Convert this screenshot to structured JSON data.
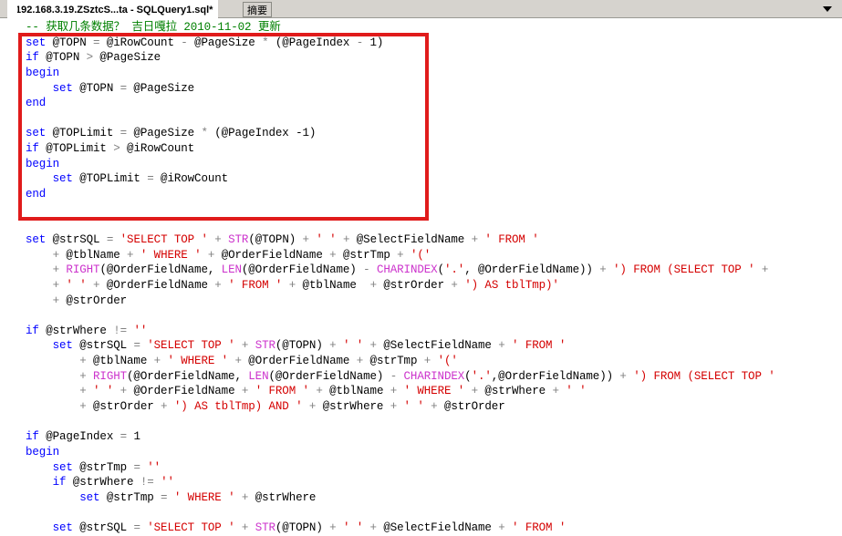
{
  "window": {
    "tab_title": "192.168.3.19.ZSztcS...ta - SQLQuery1.sql*",
    "summary_tab_label": "摘要",
    "dropdown_icon": "chevron-down-icon"
  },
  "annotation": {
    "box_color": "#e01b1b",
    "shape": "rectangle",
    "covers_lines": "1-13"
  },
  "colors": {
    "comment": "#008000",
    "keyword": "#0000ff",
    "string": "#d40000",
    "function": "#cc33cc",
    "operator": "#808080",
    "identifier": "#000000",
    "tabstrip_bg": "#d6d3ce",
    "editor_bg": "#ffffff"
  },
  "editor": {
    "language": "T-SQL",
    "lines": [
      [
        {
          "t": "-- 获取几条数据？ 吉日嘎拉 2010-11-02 更新",
          "c": "cm"
        }
      ],
      [
        {
          "t": "set",
          "c": "kw"
        },
        {
          "t": " @TOPN ",
          "c": "var"
        },
        {
          "t": "=",
          "c": "op"
        },
        {
          "t": " @iRowCount ",
          "c": "var"
        },
        {
          "t": "-",
          "c": "op"
        },
        {
          "t": " @PageSize ",
          "c": "var"
        },
        {
          "t": "*",
          "c": "op"
        },
        {
          "t": " (@PageIndex ",
          "c": "var"
        },
        {
          "t": "-",
          "c": "op"
        },
        {
          "t": " 1)",
          "c": "var"
        }
      ],
      [
        {
          "t": "if",
          "c": "kw"
        },
        {
          "t": " @TOPN ",
          "c": "var"
        },
        {
          "t": ">",
          "c": "op"
        },
        {
          "t": " @PageSize",
          "c": "var"
        }
      ],
      [
        {
          "t": "begin",
          "c": "kw"
        }
      ],
      [
        {
          "t": "    set",
          "c": "kw"
        },
        {
          "t": " @TOPN ",
          "c": "var"
        },
        {
          "t": "=",
          "c": "op"
        },
        {
          "t": " @PageSize",
          "c": "var"
        }
      ],
      [
        {
          "t": "end",
          "c": "kw"
        }
      ],
      [
        {
          "t": "",
          "c": "var"
        }
      ],
      [
        {
          "t": "set",
          "c": "kw"
        },
        {
          "t": " @TOPLimit ",
          "c": "var"
        },
        {
          "t": "=",
          "c": "op"
        },
        {
          "t": " @PageSize ",
          "c": "var"
        },
        {
          "t": "*",
          "c": "op"
        },
        {
          "t": " (@PageIndex ",
          "c": "var"
        },
        {
          "t": "-1)",
          "c": "var"
        }
      ],
      [
        {
          "t": "if",
          "c": "kw"
        },
        {
          "t": " @TOPLimit ",
          "c": "var"
        },
        {
          "t": ">",
          "c": "op"
        },
        {
          "t": " @iRowCount",
          "c": "var"
        }
      ],
      [
        {
          "t": "begin",
          "c": "kw"
        }
      ],
      [
        {
          "t": "    set",
          "c": "kw"
        },
        {
          "t": " @TOPLimit ",
          "c": "var"
        },
        {
          "t": "=",
          "c": "op"
        },
        {
          "t": " @iRowCount",
          "c": "var"
        }
      ],
      [
        {
          "t": "end",
          "c": "kw"
        }
      ],
      [
        {
          "t": "",
          "c": "var"
        }
      ],
      [
        {
          "t": "",
          "c": "var"
        }
      ],
      [
        {
          "t": "set",
          "c": "kw"
        },
        {
          "t": " @strSQL ",
          "c": "var"
        },
        {
          "t": "=",
          "c": "op"
        },
        {
          "t": " ",
          "c": "var"
        },
        {
          "t": "'SELECT TOP '",
          "c": "str"
        },
        {
          "t": " + ",
          "c": "op"
        },
        {
          "t": "STR",
          "c": "fn"
        },
        {
          "t": "(@TOPN)",
          "c": "var"
        },
        {
          "t": " + ",
          "c": "op"
        },
        {
          "t": "' '",
          "c": "str"
        },
        {
          "t": " + ",
          "c": "op"
        },
        {
          "t": "@SelectFieldName",
          "c": "var"
        },
        {
          "t": " + ",
          "c": "op"
        },
        {
          "t": "' FROM '",
          "c": "str"
        }
      ],
      [
        {
          "t": "    + ",
          "c": "op"
        },
        {
          "t": "@tblName",
          "c": "var"
        },
        {
          "t": " + ",
          "c": "op"
        },
        {
          "t": "' WHERE '",
          "c": "str"
        },
        {
          "t": " + ",
          "c": "op"
        },
        {
          "t": "@OrderFieldName",
          "c": "var"
        },
        {
          "t": " + ",
          "c": "op"
        },
        {
          "t": "@strTmp",
          "c": "var"
        },
        {
          "t": " + ",
          "c": "op"
        },
        {
          "t": "'('",
          "c": "str"
        }
      ],
      [
        {
          "t": "    + ",
          "c": "op"
        },
        {
          "t": "RIGHT",
          "c": "fn"
        },
        {
          "t": "(@OrderFieldName, ",
          "c": "var"
        },
        {
          "t": "LEN",
          "c": "fn"
        },
        {
          "t": "(@OrderFieldName)",
          "c": "var"
        },
        {
          "t": " - ",
          "c": "op"
        },
        {
          "t": "CHARINDEX",
          "c": "fn"
        },
        {
          "t": "(",
          "c": "var"
        },
        {
          "t": "'.'",
          "c": "str"
        },
        {
          "t": ", @OrderFieldName))",
          "c": "var"
        },
        {
          "t": " + ",
          "c": "op"
        },
        {
          "t": "') FROM (SELECT TOP '",
          "c": "str"
        },
        {
          "t": " + ",
          "c": "op"
        }
      ],
      [
        {
          "t": "    + ",
          "c": "op"
        },
        {
          "t": "' '",
          "c": "str"
        },
        {
          "t": " + ",
          "c": "op"
        },
        {
          "t": "@OrderFieldName",
          "c": "var"
        },
        {
          "t": " + ",
          "c": "op"
        },
        {
          "t": "' FROM '",
          "c": "str"
        },
        {
          "t": " + ",
          "c": "op"
        },
        {
          "t": "@tblName",
          "c": "var"
        },
        {
          "t": "  + ",
          "c": "op"
        },
        {
          "t": "@strOrder",
          "c": "var"
        },
        {
          "t": " + ",
          "c": "op"
        },
        {
          "t": "') AS tblTmp)'",
          "c": "str"
        }
      ],
      [
        {
          "t": "    + ",
          "c": "op"
        },
        {
          "t": "@strOrder",
          "c": "var"
        }
      ],
      [
        {
          "t": "",
          "c": "var"
        }
      ],
      [
        {
          "t": "if",
          "c": "kw"
        },
        {
          "t": " @strWhere ",
          "c": "var"
        },
        {
          "t": "!=",
          "c": "op"
        },
        {
          "t": " ",
          "c": "var"
        },
        {
          "t": "''",
          "c": "str"
        }
      ],
      [
        {
          "t": "    set",
          "c": "kw"
        },
        {
          "t": " @strSQL ",
          "c": "var"
        },
        {
          "t": "=",
          "c": "op"
        },
        {
          "t": " ",
          "c": "var"
        },
        {
          "t": "'SELECT TOP '",
          "c": "str"
        },
        {
          "t": " + ",
          "c": "op"
        },
        {
          "t": "STR",
          "c": "fn"
        },
        {
          "t": "(@TOPN)",
          "c": "var"
        },
        {
          "t": " + ",
          "c": "op"
        },
        {
          "t": "' '",
          "c": "str"
        },
        {
          "t": " + ",
          "c": "op"
        },
        {
          "t": "@SelectFieldName",
          "c": "var"
        },
        {
          "t": " + ",
          "c": "op"
        },
        {
          "t": "' FROM '",
          "c": "str"
        }
      ],
      [
        {
          "t": "        + ",
          "c": "op"
        },
        {
          "t": "@tblName",
          "c": "var"
        },
        {
          "t": " + ",
          "c": "op"
        },
        {
          "t": "' WHERE '",
          "c": "str"
        },
        {
          "t": " + ",
          "c": "op"
        },
        {
          "t": "@OrderFieldName",
          "c": "var"
        },
        {
          "t": " + ",
          "c": "op"
        },
        {
          "t": "@strTmp",
          "c": "var"
        },
        {
          "t": " + ",
          "c": "op"
        },
        {
          "t": "'('",
          "c": "str"
        }
      ],
      [
        {
          "t": "        + ",
          "c": "op"
        },
        {
          "t": "RIGHT",
          "c": "fn"
        },
        {
          "t": "(@OrderFieldName, ",
          "c": "var"
        },
        {
          "t": "LEN",
          "c": "fn"
        },
        {
          "t": "(@OrderFieldName)",
          "c": "var"
        },
        {
          "t": " - ",
          "c": "op"
        },
        {
          "t": "CHARINDEX",
          "c": "fn"
        },
        {
          "t": "(",
          "c": "var"
        },
        {
          "t": "'.'",
          "c": "str"
        },
        {
          "t": ",@OrderFieldName))",
          "c": "var"
        },
        {
          "t": " + ",
          "c": "op"
        },
        {
          "t": "') FROM (SELECT TOP '",
          "c": "str"
        }
      ],
      [
        {
          "t": "        + ",
          "c": "op"
        },
        {
          "t": "' '",
          "c": "str"
        },
        {
          "t": " + ",
          "c": "op"
        },
        {
          "t": "@OrderFieldName",
          "c": "var"
        },
        {
          "t": " + ",
          "c": "op"
        },
        {
          "t": "' FROM '",
          "c": "str"
        },
        {
          "t": " + ",
          "c": "op"
        },
        {
          "t": "@tblName",
          "c": "var"
        },
        {
          "t": " + ",
          "c": "op"
        },
        {
          "t": "' WHERE '",
          "c": "str"
        },
        {
          "t": " + ",
          "c": "op"
        },
        {
          "t": "@strWhere",
          "c": "var"
        },
        {
          "t": " + ",
          "c": "op"
        },
        {
          "t": "' '",
          "c": "str"
        }
      ],
      [
        {
          "t": "        + ",
          "c": "op"
        },
        {
          "t": "@strOrder",
          "c": "var"
        },
        {
          "t": " + ",
          "c": "op"
        },
        {
          "t": "') AS tblTmp) AND '",
          "c": "str"
        },
        {
          "t": " + ",
          "c": "op"
        },
        {
          "t": "@strWhere",
          "c": "var"
        },
        {
          "t": " + ",
          "c": "op"
        },
        {
          "t": "' '",
          "c": "str"
        },
        {
          "t": " + ",
          "c": "op"
        },
        {
          "t": "@strOrder",
          "c": "var"
        }
      ],
      [
        {
          "t": "",
          "c": "var"
        }
      ],
      [
        {
          "t": "if",
          "c": "kw"
        },
        {
          "t": " @PageIndex ",
          "c": "var"
        },
        {
          "t": "=",
          "c": "op"
        },
        {
          "t": " 1",
          "c": "var"
        }
      ],
      [
        {
          "t": "begin",
          "c": "kw"
        }
      ],
      [
        {
          "t": "    set",
          "c": "kw"
        },
        {
          "t": " @strTmp ",
          "c": "var"
        },
        {
          "t": "=",
          "c": "op"
        },
        {
          "t": " ",
          "c": "var"
        },
        {
          "t": "''",
          "c": "str"
        }
      ],
      [
        {
          "t": "    if",
          "c": "kw"
        },
        {
          "t": " @strWhere ",
          "c": "var"
        },
        {
          "t": "!=",
          "c": "op"
        },
        {
          "t": " ",
          "c": "var"
        },
        {
          "t": "''",
          "c": "str"
        }
      ],
      [
        {
          "t": "        set",
          "c": "kw"
        },
        {
          "t": " @strTmp ",
          "c": "var"
        },
        {
          "t": "=",
          "c": "op"
        },
        {
          "t": " ",
          "c": "var"
        },
        {
          "t": "' WHERE '",
          "c": "str"
        },
        {
          "t": " + ",
          "c": "op"
        },
        {
          "t": "@strWhere",
          "c": "var"
        }
      ],
      [
        {
          "t": "",
          "c": "var"
        }
      ],
      [
        {
          "t": "    set",
          "c": "kw"
        },
        {
          "t": " @strSQL ",
          "c": "var"
        },
        {
          "t": "=",
          "c": "op"
        },
        {
          "t": " ",
          "c": "var"
        },
        {
          "t": "'SELECT TOP '",
          "c": "str"
        },
        {
          "t": " + ",
          "c": "op"
        },
        {
          "t": "STR",
          "c": "fn"
        },
        {
          "t": "(@TOPN)",
          "c": "var"
        },
        {
          "t": " + ",
          "c": "op"
        },
        {
          "t": "' '",
          "c": "str"
        },
        {
          "t": " + ",
          "c": "op"
        },
        {
          "t": "@SelectFieldName",
          "c": "var"
        },
        {
          "t": " + ",
          "c": "op"
        },
        {
          "t": "' FROM '",
          "c": "str"
        }
      ]
    ]
  }
}
